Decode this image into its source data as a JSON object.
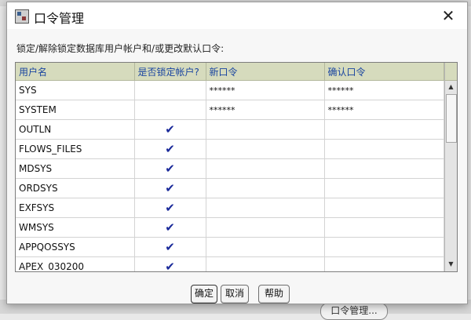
{
  "background": {
    "button_label": "口令管理..."
  },
  "dialog": {
    "title": "口令管理",
    "description": "锁定/解除锁定数据库用户帐户和/或更改默认口令:",
    "columns": [
      "用户名",
      "是否锁定帐户?",
      "新口令",
      "确认口令"
    ],
    "rows": [
      {
        "user": "SYS",
        "locked": "",
        "new_password": "******",
        "confirm_password": "******"
      },
      {
        "user": "SYSTEM",
        "locked": "",
        "new_password": "******",
        "confirm_password": "******"
      },
      {
        "user": "OUTLN",
        "locked": "✔",
        "new_password": "",
        "confirm_password": ""
      },
      {
        "user": "FLOWS_FILES",
        "locked": "✔",
        "new_password": "",
        "confirm_password": ""
      },
      {
        "user": "MDSYS",
        "locked": "✔",
        "new_password": "",
        "confirm_password": ""
      },
      {
        "user": "ORDSYS",
        "locked": "✔",
        "new_password": "",
        "confirm_password": ""
      },
      {
        "user": "EXFSYS",
        "locked": "✔",
        "new_password": "",
        "confirm_password": ""
      },
      {
        "user": "WMSYS",
        "locked": "✔",
        "new_password": "",
        "confirm_password": ""
      },
      {
        "user": "APPQOSSYS",
        "locked": "✔",
        "new_password": "",
        "confirm_password": ""
      },
      {
        "user": "APEX_030200",
        "locked": "✔",
        "new_password": "",
        "confirm_password": ""
      }
    ],
    "buttons": {
      "ok": "确定",
      "cancel": "取消",
      "help": "帮助"
    },
    "icons": {
      "close": "✕",
      "scroll_up": "▲",
      "scroll_down": "▼"
    }
  }
}
